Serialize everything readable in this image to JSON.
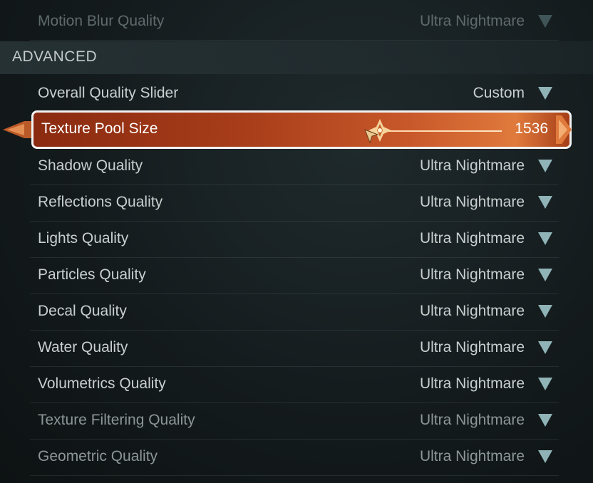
{
  "top_row": {
    "label": "Motion Blur Quality",
    "value": "Ultra Nightmare"
  },
  "section": {
    "title": "ADVANCED"
  },
  "overall": {
    "label": "Overall Quality Slider",
    "value": "Custom"
  },
  "texture_pool": {
    "label": "Texture Pool Size",
    "value": "1536"
  },
  "rows": [
    {
      "label": "Shadow Quality",
      "value": "Ultra Nightmare"
    },
    {
      "label": "Reflections Quality",
      "value": "Ultra Nightmare"
    },
    {
      "label": "Lights Quality",
      "value": "Ultra Nightmare"
    },
    {
      "label": "Particles Quality",
      "value": "Ultra Nightmare"
    },
    {
      "label": "Decal Quality",
      "value": "Ultra Nightmare"
    },
    {
      "label": "Water Quality",
      "value": "Ultra Nightmare"
    },
    {
      "label": "Volumetrics Quality",
      "value": "Ultra Nightmare"
    },
    {
      "label": "Texture Filtering Quality",
      "value": "Ultra Nightmare"
    },
    {
      "label": "Geometric Quality",
      "value": "Ultra Nightmare"
    }
  ],
  "icons": {
    "dropdown": "chevron-down-icon",
    "slider": "slider-thumb-icon",
    "cursor": "pointer-cursor-icon"
  },
  "colors": {
    "accent": "#c8582a",
    "dropdown": "#8fb3b6"
  }
}
